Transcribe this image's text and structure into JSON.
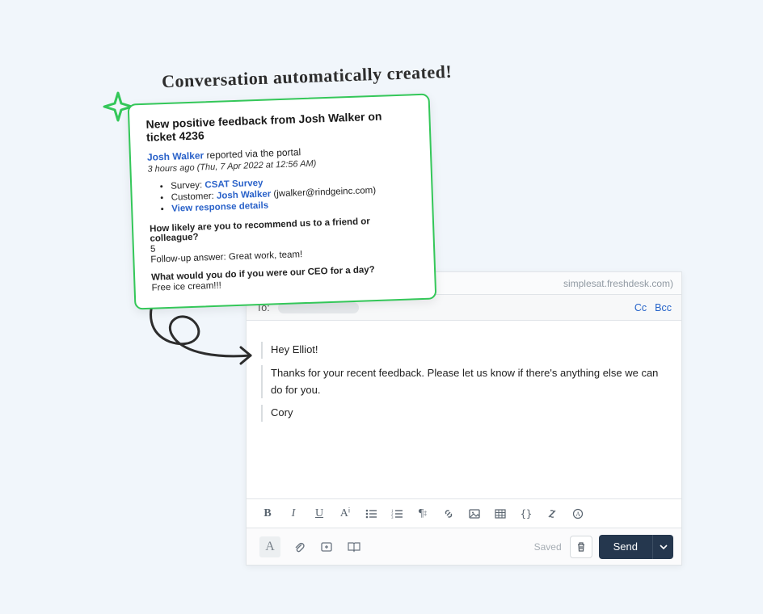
{
  "callout": "Conversation automatically created!",
  "feedback": {
    "title": "New positive feedback from Josh Walker on ticket 4236",
    "reporter_name": "Josh Walker",
    "reported_via": " reported via the portal",
    "timestamp": "3 hours ago (Thu, 7 Apr 2022 at 12:56 AM)",
    "survey_label": "Survey: ",
    "survey_link": "CSAT Survey",
    "customer_label": "Customer: ",
    "customer_link": "Josh Walker",
    "customer_email": " (jwalker@rindgeinc.com)",
    "view_details": "View response details",
    "q1": "How likely are you to recommend us to a friend or colleague?",
    "a1_score": "5",
    "a1_followup": "Follow-up answer: Great work, team!",
    "q2": "What would you do if you were our CEO for a day?",
    "a2": "Free ice cream!!!"
  },
  "compose": {
    "from_suffix": "simplesat.freshdesk.com)",
    "to_label": "To:",
    "cc": "Cc",
    "bcc": "Bcc",
    "body_line1": "Hey Elliot!",
    "body_line2": "Thanks for your recent feedback. Please let us know if there's anything else we can do for you.",
    "body_line3": "Cory",
    "saved": "Saved",
    "send": "Send"
  },
  "toolbar": {
    "bold": "B",
    "italic": "I",
    "underline": "U",
    "font": "Aⁱ",
    "bullets": "≡",
    "numbers": "≡",
    "para": "¶",
    "link": "🔗",
    "image": "▣",
    "table": "⊞",
    "code": "{}",
    "strike": "S̷",
    "clear": "Ⓐ"
  }
}
